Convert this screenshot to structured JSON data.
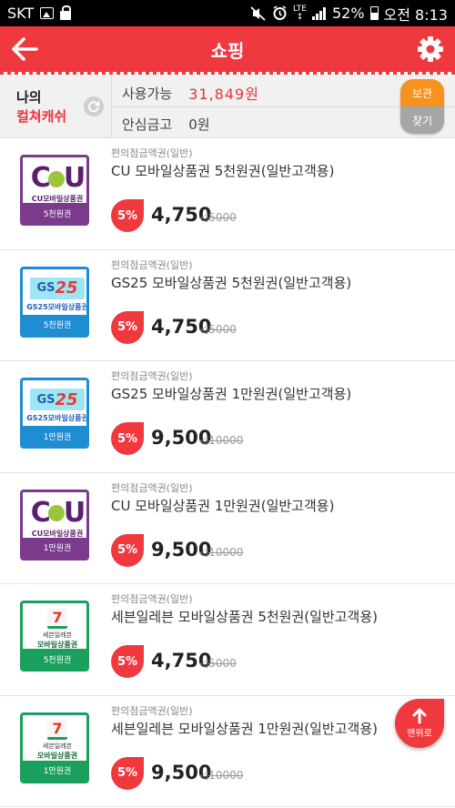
{
  "status_bar": {
    "carrier": "SKT",
    "network": "LTE",
    "battery": "52%",
    "time": "오전 8:13"
  },
  "header": {
    "title": "쇼핑",
    "accent": "#f0393f"
  },
  "cash_panel": {
    "label_line1": "나의",
    "label_line2": "컬쳐캐쉬",
    "available_label": "사용가능",
    "available_value": "31,849원",
    "safe_label": "안심금고",
    "safe_value": "0원",
    "vault_top": "보관",
    "vault_bottom": "찾기"
  },
  "products": [
    {
      "brand": "cu",
      "category": "편의점금액권(일반)",
      "name": "CU 모바일상품권 5천원권(일반고객용)",
      "discount": "5%",
      "price": "4,750",
      "original": "5000",
      "logo_text": "CU모바일상품권",
      "denomination": "5천원권"
    },
    {
      "brand": "gs",
      "category": "편의점금액권(일반)",
      "name": "GS25 모바일상품권 5천원권(일반고객용)",
      "discount": "5%",
      "price": "4,750",
      "original": "5000",
      "logo_text": "GS25모바일상품권",
      "denomination": "5천원권"
    },
    {
      "brand": "gs",
      "category": "편의점금액권(일반)",
      "name": "GS25 모바일상품권 1만원권(일반고객용)",
      "discount": "5%",
      "price": "9,500",
      "original": "10000",
      "logo_text": "GS25모바일상품권",
      "denomination": "1만원권"
    },
    {
      "brand": "cu",
      "category": "편의점금액권(일반)",
      "name": "CU 모바일상품권 1만원권(일반고객용)",
      "discount": "5%",
      "price": "9,500",
      "original": "10000",
      "logo_text": "CU모바일상품권",
      "denomination": "1만원권"
    },
    {
      "brand": "se",
      "category": "편의점금액권(일반)",
      "name": "세븐일레븐 모바일상품권 5천원권(일반고객용)",
      "discount": "5%",
      "price": "4,750",
      "original": "5000",
      "logo_text": "모바일상품권",
      "logo_small": "세븐일레븐",
      "denomination": "5천원권"
    },
    {
      "brand": "se",
      "category": "편의점금액권(일반)",
      "name": "세븐일레븐 모바일상품권 1만원권(일반고객용)",
      "discount": "5%",
      "price": "9,500",
      "original": "10000",
      "logo_text": "모바일상품권",
      "logo_small": "세븐일레븐",
      "denomination": "1만원권"
    }
  ],
  "scroll_top": {
    "label": "맨위로"
  }
}
